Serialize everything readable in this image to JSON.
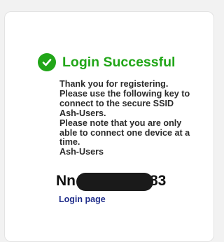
{
  "colors": {
    "success": "#21a618",
    "link": "#1f2d8a",
    "redaction": "#1a1a1a"
  },
  "header": {
    "icon": "check-circle-icon",
    "title": "Login Successful"
  },
  "message": {
    "lines": [
      "Thank you for registering.",
      "Please use the following key to",
      "connect to the secure SSID",
      "Ash-Users.",
      "Please note that you are only",
      "able to connect one device at a",
      "time.",
      "Ash-Users"
    ]
  },
  "key": {
    "prefix": "Nn",
    "suffix": "83"
  },
  "link": {
    "label": "Login page"
  }
}
